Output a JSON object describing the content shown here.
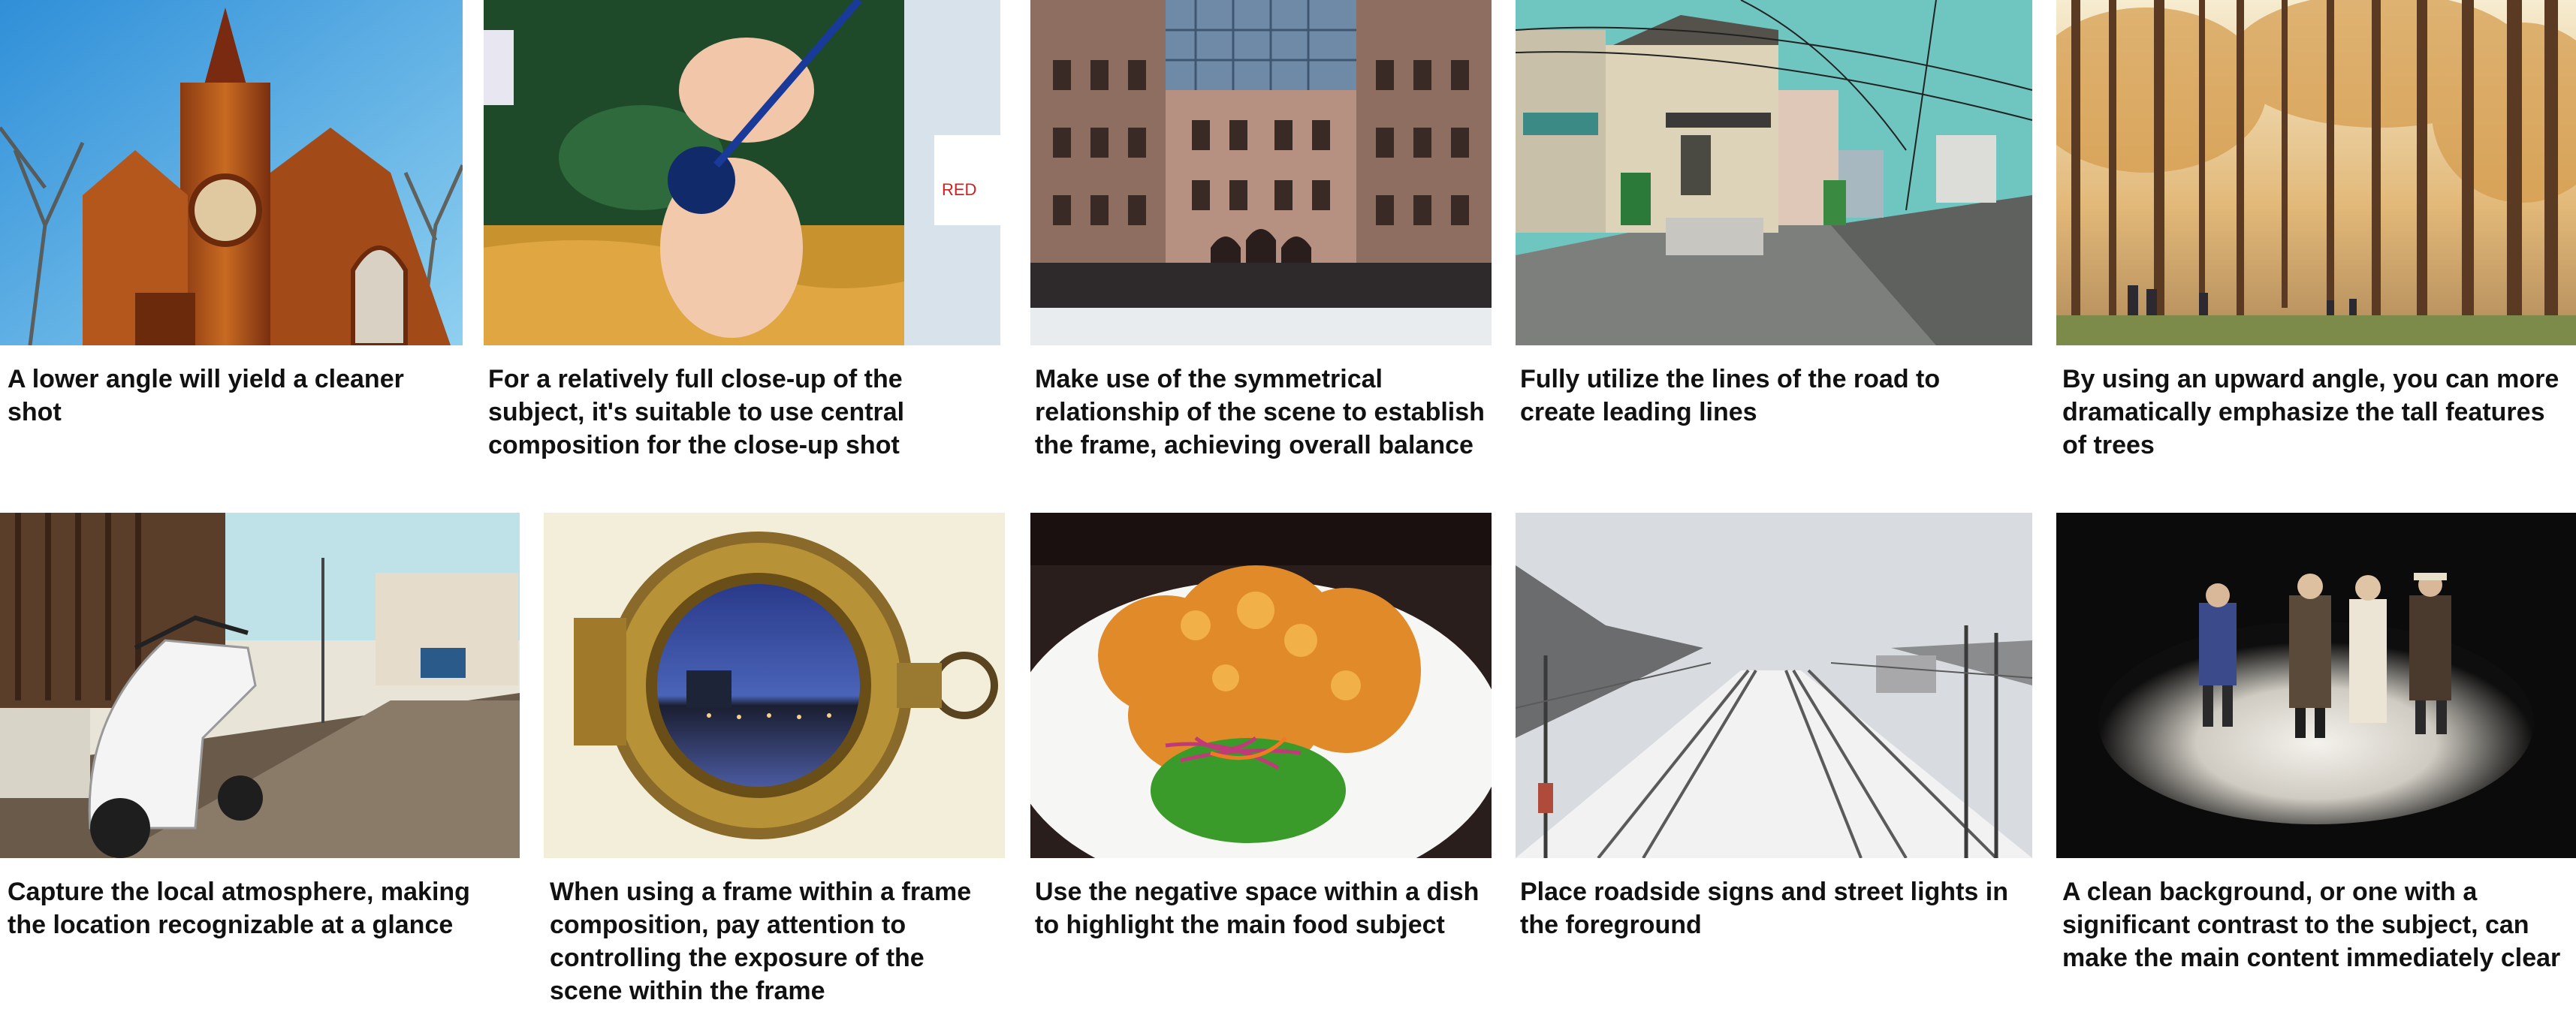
{
  "tips": [
    {
      "id": "church",
      "icon": "church-photo",
      "caption": "A lower angle will yield a cleaner shot"
    },
    {
      "id": "painting",
      "icon": "painting-closeup-photo",
      "caption": "For a relatively full close-up of the subject, it's suitable to use central composition for the close-up shot"
    },
    {
      "id": "building",
      "icon": "symmetrical-building-photo",
      "caption": "Make use of the symmetrical relationship of the scene to establish the frame, achieving overall balance"
    },
    {
      "id": "street",
      "icon": "street-house-photo",
      "caption": "Fully utilize the lines of the road to create leading lines"
    },
    {
      "id": "trees",
      "icon": "tall-trees-photo",
      "caption": "By using an upward angle, you can more dramatically emphasize the tall features of trees"
    },
    {
      "id": "scooter",
      "icon": "scooter-street-photo",
      "caption": "Capture the local atmosphere, making the location recognizable at a glance"
    },
    {
      "id": "porthole",
      "icon": "porthole-photo",
      "caption": "When using a frame within a frame composition, pay attention to controlling the exposure of the scene within the frame"
    },
    {
      "id": "food",
      "icon": "fried-food-dish-photo",
      "caption": "Use the negative space within a dish to highlight the main food subject"
    },
    {
      "id": "railway",
      "icon": "snowy-railway-photo",
      "caption": "Place roadside signs and street lights in the foreground"
    },
    {
      "id": "figures",
      "icon": "figurines-spotlight-photo",
      "caption": "A clean background, or one with a significant contrast to the subject, can make the main content immediately clear"
    }
  ]
}
